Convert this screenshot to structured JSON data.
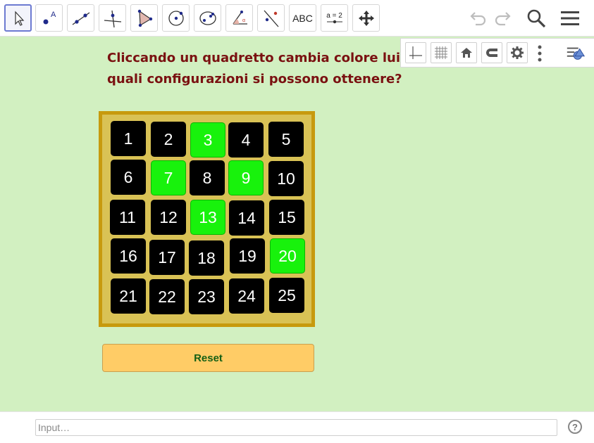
{
  "toolbar": {
    "tools": [
      {
        "name": "move-tool",
        "icon": "pointer-arrow-icon",
        "active": true
      },
      {
        "name": "point-tool",
        "icon": "point-icon"
      },
      {
        "name": "line-tool",
        "icon": "line-icon"
      },
      {
        "name": "perpendicular-line-tool",
        "icon": "perpendicular-line-icon"
      },
      {
        "name": "polygon-tool",
        "icon": "polygon-icon"
      },
      {
        "name": "circle-tool",
        "icon": "circle-with-center-icon"
      },
      {
        "name": "ellipse-tool",
        "icon": "ellipse-icon"
      },
      {
        "name": "angle-tool",
        "icon": "angle-icon"
      },
      {
        "name": "reflect-tool",
        "icon": "reflect-line-icon"
      },
      {
        "name": "text-tool",
        "label": "ABC"
      },
      {
        "name": "slider-tool",
        "label": "a = 2"
      },
      {
        "name": "move-graphics-view-tool",
        "icon": "move-cross-arrows-icon"
      }
    ]
  },
  "question": {
    "line1": "Cliccando un quadretto cambia colore lui e i",
    "line2": "quali configurazioni si possono ottenere?"
  },
  "board": {
    "tiles": [
      {
        "label": "1",
        "on": false
      },
      {
        "label": "2",
        "on": false
      },
      {
        "label": "3",
        "on": true
      },
      {
        "label": "4",
        "on": false
      },
      {
        "label": "5",
        "on": false
      },
      {
        "label": "6",
        "on": false
      },
      {
        "label": "7",
        "on": true
      },
      {
        "label": "8",
        "on": false
      },
      {
        "label": "9",
        "on": true
      },
      {
        "label": "10",
        "on": false
      },
      {
        "label": "11",
        "on": false
      },
      {
        "label": "12",
        "on": false
      },
      {
        "label": "13",
        "on": true
      },
      {
        "label": "14",
        "on": false
      },
      {
        "label": "15",
        "on": false
      },
      {
        "label": "16",
        "on": false
      },
      {
        "label": "17",
        "on": false
      },
      {
        "label": "18",
        "on": false
      },
      {
        "label": "19",
        "on": false
      },
      {
        "label": "20",
        "on": true
      },
      {
        "label": "21",
        "on": false
      },
      {
        "label": "22",
        "on": false
      },
      {
        "label": "23",
        "on": false
      },
      {
        "label": "24",
        "on": false
      },
      {
        "label": "25",
        "on": false
      }
    ]
  },
  "reset": {
    "label": "Reset"
  },
  "input_bar": {
    "placeholder": "Input…",
    "help_label": "?"
  },
  "colors": {
    "background": "#d2f0c1",
    "tile_off": "#000000",
    "tile_on": "#18f20c",
    "board_frame": "#c79a0e",
    "question_text": "#7a1111",
    "reset_bg": "#ffcc66",
    "reset_text": "#145f14"
  }
}
